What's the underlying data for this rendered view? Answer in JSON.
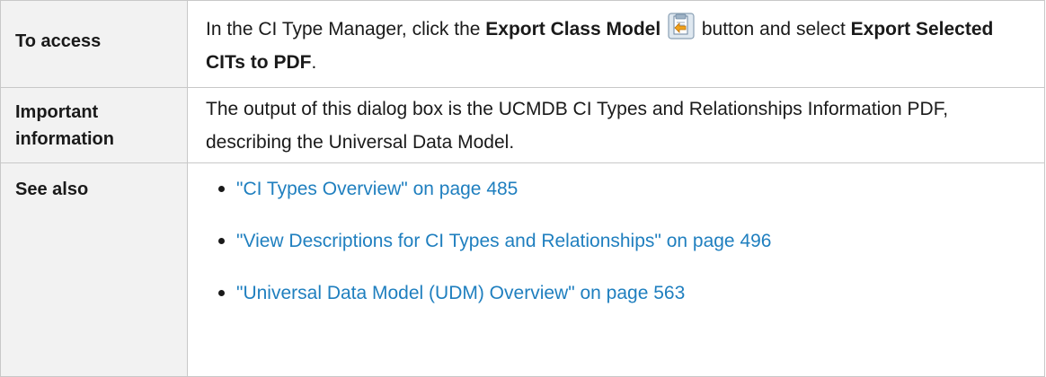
{
  "rows": {
    "access": {
      "label": "To access",
      "text_1": "In the CI Type Manager, click the ",
      "bold_1": "Export Class Model",
      "icon": "export-class-model-icon",
      "text_2": " button and select ",
      "bold_2": "Export Selected CITs to PDF",
      "text_3": "."
    },
    "info": {
      "label": "Important information",
      "text": "The output of this dialog box is the UCMDB CI Types and Relationships Information PDF, describing the Universal Data Model."
    },
    "see_also": {
      "label": "See also",
      "links": [
        {
          "text": "\"CI Types Overview\" on page 485"
        },
        {
          "text": "\"View Descriptions for CI Types and Relationships\" on page 496"
        },
        {
          "text": "\"Universal Data Model (UDM) Overview\" on page 563"
        }
      ]
    }
  },
  "colors": {
    "link": "#1f7fbf",
    "header_bg": "#f2f2f2",
    "border": "#c8c8c8"
  }
}
